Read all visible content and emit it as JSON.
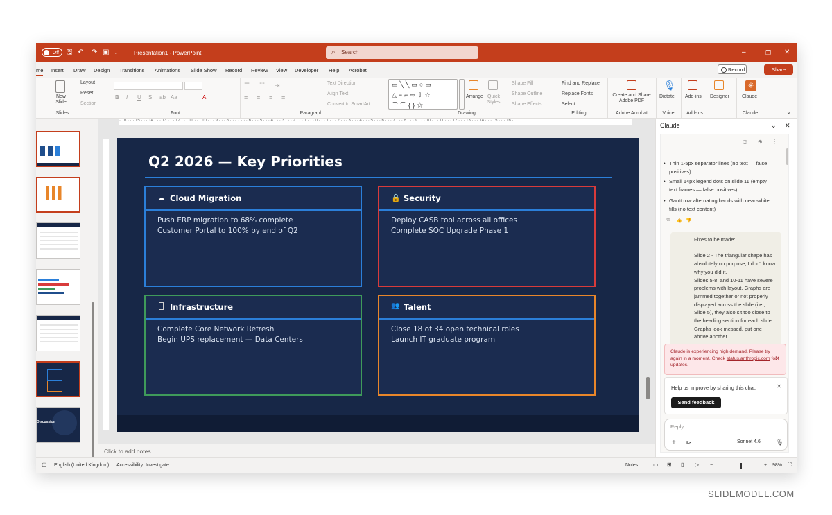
{
  "titlebar": {
    "autosave_toggle": "Off",
    "document_title": "Presentation1 - PowerPoint",
    "search_placeholder": "Search"
  },
  "tabs": [
    "me",
    "Insert",
    "Draw",
    "Design",
    "Transitions",
    "Animations",
    "Slide Show",
    "Record",
    "Review",
    "View",
    "Developer",
    "Help",
    "Acrobat"
  ],
  "tab_buttons": {
    "record": "Record",
    "share": "Share"
  },
  "ribbon": {
    "slides": {
      "new_slide": "New Slide",
      "layout": "Layout",
      "reset": "Reset",
      "section": "Section",
      "label": "Slides"
    },
    "font": {
      "label": "Font"
    },
    "paragraph": {
      "text_direction": "Text Direction",
      "align_text": "Align Text",
      "convert": "Convert to SmartArt",
      "label": "Paragraph"
    },
    "drawing": {
      "arrange": "Arrange",
      "quick_styles": "Quick Styles",
      "shape_fill": "Shape Fill",
      "shape_outline": "Shape Outline",
      "shape_effects": "Shape Effects",
      "label": "Drawing"
    },
    "editing": {
      "find_replace": "Find and Replace",
      "replace_fonts": "Replace Fonts",
      "select": "Select",
      "label": "Editing"
    },
    "acrobat": {
      "create_share": "Create and Share Adobe PDF",
      "label": "Adobe Acrobat"
    },
    "voice": {
      "dictate": "Dictate",
      "label": "Voice"
    },
    "addins": {
      "addins": "Add-ins",
      "designer": "Designer",
      "label": "Add-ins"
    },
    "claude": {
      "button": "Claude",
      "label": "Claude"
    }
  },
  "slide": {
    "title": "Q2 2026 — Key Priorities",
    "cards": [
      {
        "title": "Cloud Migration",
        "icon": "cloud-icon",
        "border": "#2b7fd9",
        "lines": [
          "Push ERP migration to 68% complete",
          "Customer Portal to 100% by end of Q2"
        ]
      },
      {
        "title": "Security",
        "icon": "lock-icon",
        "border": "#d83b3b",
        "lines": [
          "Deploy CASB tool across all offices",
          "Complete SOC Upgrade Phase 1"
        ]
      },
      {
        "title": "Infrastructure",
        "icon": "server-icon",
        "border": "#3f9a5a",
        "lines": [
          "Complete Core Network Refresh",
          "Begin UPS replacement — Data Centers"
        ]
      },
      {
        "title": "Talent",
        "icon": "people-icon",
        "border": "#e8862a",
        "lines": [
          "Close 18 of 34 open technical roles",
          "Launch IT graduate program"
        ]
      }
    ]
  },
  "notes_placeholder": "Click to add notes",
  "claude_pane": {
    "title": "Claude",
    "bullets": [
      "Thin 1-5px separator lines (no text — false positives)",
      "Small 14px legend dots on slide 11 (empty text frames — false positives)",
      "Gantt row alternating bands with near-white fills (no text content)"
    ],
    "user_message": "Fixes to be made:\n\nSlide 2 - The triangular shape has absolutely no purpose, I don't know why you did it.\nSlides 5-8  and 10-11 have severe problems with layout. Graphs are jammed together or not properly displayed across the slide (i.e., Slide 5), they also sit too close to the heading section for each slide. Graphs look messed, put one above another",
    "error_text": "Claude is experiencing high demand. Please try again in a moment. Check",
    "error_link": "status.anthropic.com",
    "error_suffix": "for updates.",
    "feedback_prompt": "Help us improve by sharing this chat.",
    "feedback_button": "Send feedback",
    "reply_placeholder": "Reply",
    "model": "Sonnet 4.6"
  },
  "statusbar": {
    "language": "English (United Kingdom)",
    "accessibility": "Accessibility: Investigate",
    "notes": "Notes",
    "zoom": "98%"
  },
  "ruler_ticks": "· 16 · · · 15 · · · 14 · · · 13 · · · 12 · · · 11 · · · 10 · · · 9 · · · 8 · · · 7 · · · 6 · · · 5 · · · 4 · · · 3 · · · 2 · · · 1 · · · 0 · · · 1 · · · 2 · · · 3 · · · 4 · · · 5 · · · 6 · · · 7 · · · 8 · · · 9 · · · 10 · · · 11 · · · 12 · · · 13 · · · 14 · · · 15 · · · 16 ·",
  "watermark": "SLIDEMODEL.COM"
}
